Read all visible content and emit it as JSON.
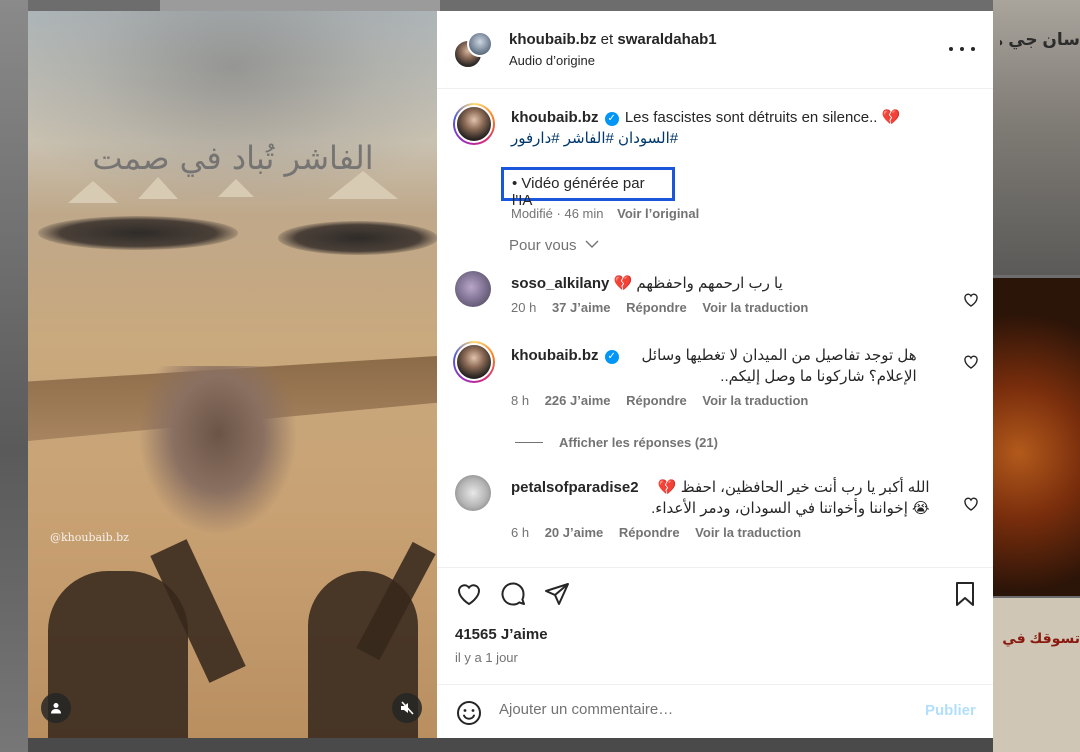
{
  "media": {
    "overlay_text": "الفاشر تُباد في صمت",
    "watermark": "@khoubaib.bz"
  },
  "background": {
    "ar_text_1": "سان جي ما تضرب",
    "ar_text_2": "تسوقك في أرباحها إلى المستقبل"
  },
  "header": {
    "user1": "khoubaib.bz",
    "joiner": "et",
    "user2": "swaraldahab1",
    "audio": "Audio d’origine"
  },
  "caption": {
    "username": "khoubaib.bz",
    "text": "Les fascistes sont détruits en silence..",
    "emoji": "💔",
    "hashtags": "#السودان #الفاشر #دارفور",
    "ai_note": "• Vidéo générée par l'IA",
    "modified": "Modifié · 46 min",
    "see_original": "Voir l’original"
  },
  "see_more": "Pour vous",
  "comments": [
    {
      "username": "soso_alkilany",
      "text": "يا رب ارحمهم واحفظهم 💔",
      "time": "20 h",
      "likes": "37 J’aime",
      "reply": "Répondre",
      "translate": "Voir la traduction"
    },
    {
      "username": "khoubaib.bz",
      "text": "هل توجد تفاصيل من الميدان لا تغطيها وسائل الإعلام؟ شاركونا ما وصل إليكم..",
      "time": "8 h",
      "likes": "226 J’aime",
      "reply": "Répondre",
      "translate": "Voir la traduction"
    },
    {
      "username": "petalsofparadise2",
      "text": "الله أكبر يا رب أنت خير الحافظين، احفظ 💔😭 إخواننا وأخواتنا في السودان، ودمر الأعداء.",
      "time": "6 h",
      "likes": "20 J’aime",
      "reply": "Répondre",
      "translate": "Voir la traduction"
    }
  ],
  "show_replies": "Afficher les réponses (21)",
  "footer": {
    "like_count": "41565 J’aime",
    "time_ago": "il y a 1 jour",
    "comment_placeholder": "Ajouter un commentaire…",
    "publish": "Publier"
  },
  "icons": {
    "heart": "heart-icon",
    "comment": "comment-icon",
    "share": "send-icon",
    "save": "bookmark-icon",
    "emoji": "smiley-icon",
    "mute": "speaker-muted-icon",
    "user": "user-icon",
    "more": "more-horizontal-icon"
  },
  "colors": {
    "link": "#00376b",
    "verified": "#0095f6",
    "ai_box_border": "#1a56db",
    "publish_disabled": "#b2dffc",
    "muted_text": "#737373"
  }
}
